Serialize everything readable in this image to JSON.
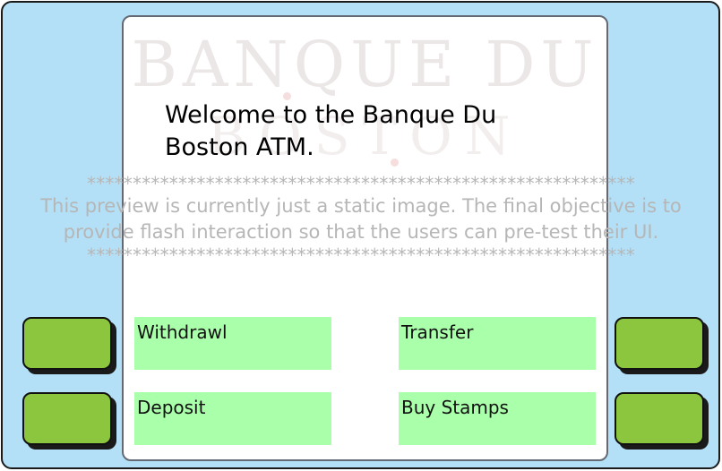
{
  "screen": {
    "logo_line1": "BANQUE DU",
    "logo_line2": "BOSTON",
    "welcome": "Welcome to the Banque Du Boston ATM."
  },
  "menu": {
    "withdrawl": "Withdrawl",
    "transfer": "Transfer",
    "deposit": "Deposit",
    "buy_stamps": "Buy Stamps"
  },
  "notice": {
    "stars": "************************************************************",
    "text": "This preview is currently just a static image. The final objective is to provide flash interaction so that the users can pre-test their UI."
  },
  "colors": {
    "frame": "#b3e0f7",
    "side_button": "#8cc63f",
    "menu_button": "#aaffaa",
    "screen_border": "#636a73"
  }
}
